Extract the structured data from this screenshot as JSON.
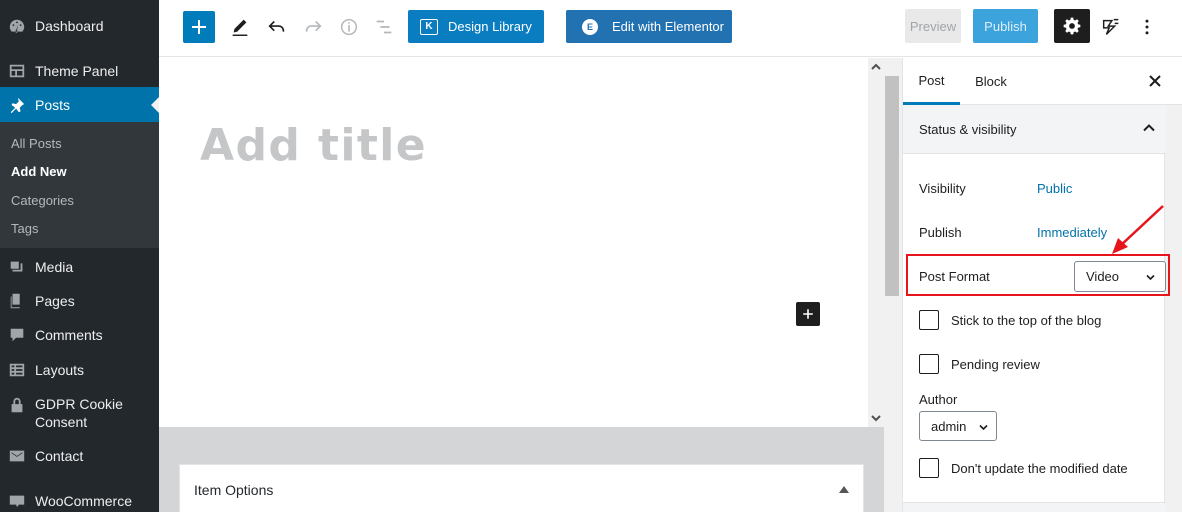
{
  "admin_menu": {
    "items": [
      {
        "label": "Dashboard",
        "icon": "dashboard-icon"
      },
      {
        "label": "Theme Panel",
        "icon": "theme-panel-icon"
      },
      {
        "label": "Posts",
        "icon": "pin-icon",
        "active": true
      },
      {
        "label": "Media",
        "icon": "media-icon"
      },
      {
        "label": "Pages",
        "icon": "pages-icon"
      },
      {
        "label": "Comments",
        "icon": "comments-icon"
      },
      {
        "label": "Layouts",
        "icon": "layouts-icon"
      },
      {
        "label": "GDPR Cookie Consent",
        "icon": "lock-icon"
      },
      {
        "label": "Contact",
        "icon": "mail-icon"
      },
      {
        "label": "WooCommerce",
        "icon": "woocommerce-icon"
      }
    ],
    "submenu": [
      "All Posts",
      "Add New",
      "Categories",
      "Tags"
    ],
    "current_submenu": "Add New",
    "gdpr_line1": "GDPR Cookie",
    "gdpr_line2": "Consent"
  },
  "toolbar": {
    "design_library_label": "Design Library",
    "elementor_label": "Edit with Elementor",
    "preview_label": "Preview",
    "publish_label": "Publish",
    "design_library_glyph": "K",
    "elementor_glyph": "E"
  },
  "editor": {
    "title_placeholder": "Add title"
  },
  "meta_box": {
    "title": "Item Options"
  },
  "sidebar": {
    "tabs": [
      "Post",
      "Block"
    ],
    "active_tab": "Post",
    "status_section": "Status & visibility",
    "visibility_label": "Visibility",
    "visibility_value": "Public",
    "publish_label": "Publish",
    "publish_value": "Immediately",
    "post_format_label": "Post Format",
    "post_format_value": "Video",
    "stick_label": "Stick to the top of the blog",
    "pending_label": "Pending review",
    "author_label": "Author",
    "author_value": "admin",
    "dont_update_label": "Don't update the modified date"
  },
  "colors": {
    "admin_bg": "#23282d",
    "accent": "#0073aa",
    "highlight": "#e8141b"
  }
}
